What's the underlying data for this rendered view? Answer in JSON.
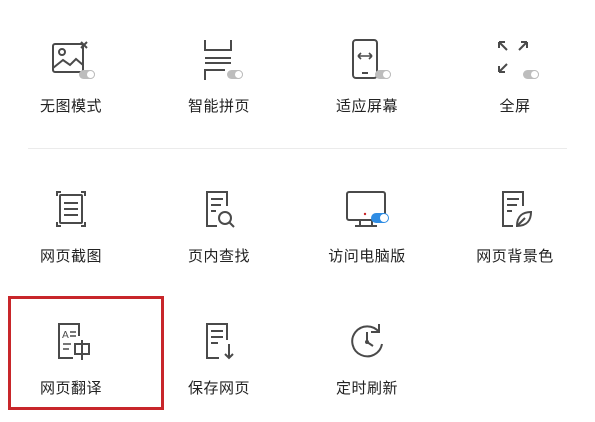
{
  "menu": {
    "row1": [
      {
        "label": "无图模式",
        "icon": "no-image-mode-icon"
      },
      {
        "label": "智能拼页",
        "icon": "smart-page-join-icon"
      },
      {
        "label": "适应屏幕",
        "icon": "fit-screen-icon"
      },
      {
        "label": "全屏",
        "icon": "fullscreen-icon"
      }
    ],
    "row2": [
      {
        "label": "网页截图",
        "icon": "screenshot-icon"
      },
      {
        "label": "页内查找",
        "icon": "find-in-page-icon"
      },
      {
        "label": "访问电脑版",
        "icon": "desktop-version-icon"
      },
      {
        "label": "网页背景色",
        "icon": "page-background-icon"
      }
    ],
    "row3": [
      {
        "label": "网页翻译",
        "icon": "translate-page-icon",
        "highlighted": true
      },
      {
        "label": "保存网页",
        "icon": "save-page-icon"
      },
      {
        "label": "定时刷新",
        "icon": "timed-refresh-icon"
      }
    ]
  },
  "colors": {
    "icon_stroke": "#4a4a4a",
    "toggle_on": "#2f8de4",
    "toggle_off": "#bdbdbd",
    "highlight_border": "#c8262a"
  }
}
